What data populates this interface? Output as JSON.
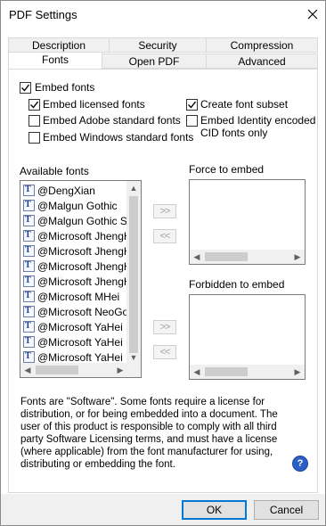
{
  "window": {
    "title": "PDF Settings"
  },
  "tabs_row_back": [
    {
      "label": "Description"
    },
    {
      "label": "Security"
    },
    {
      "label": "Compression"
    }
  ],
  "tabs_row_front": [
    {
      "label": "Fonts",
      "active": true
    },
    {
      "label": "Open PDF"
    },
    {
      "label": "Advanced"
    }
  ],
  "fonts": {
    "embed_fonts": {
      "label": "Embed fonts",
      "checked": true
    },
    "embed_licensed": {
      "label": "Embed licensed fonts",
      "checked": true
    },
    "embed_adobe": {
      "label": "Embed Adobe standard fonts",
      "checked": false
    },
    "embed_windows": {
      "label": "Embed Windows standard fonts",
      "checked": false
    },
    "create_subset": {
      "label": "Create font subset",
      "checked": true
    },
    "embed_identity": {
      "label_line1": "Embed Identity encoded",
      "label_line2": "CID fonts only",
      "checked": false
    },
    "available_label": "Available fonts",
    "force_label": "Force to embed",
    "forbidden_label": "Forbidden to embed",
    "available_fonts": [
      "@DengXian",
      "@Malgun Gothic",
      "@Malgun Gothic Semilight",
      "@Microsoft JhengHei",
      "@Microsoft JhengHei Bold",
      "@Microsoft JhengHei Light",
      "@Microsoft JhengHei UI",
      "@Microsoft MHei",
      "@Microsoft NeoGothic",
      "@Microsoft YaHei",
      "@Microsoft YaHei Light",
      "@Microsoft YaHei UI"
    ],
    "add_label": ">>",
    "remove_label": "<<",
    "description": "Fonts are \"Software\". Some fonts require a license for distribution, or for being embedded into a document. The user of this product is responsible to comply with all third party Software Licensing terms, and must have a license (where applicable) from the font manufacturer for using, distributing or embedding the font."
  },
  "buttons": {
    "ok": "OK",
    "cancel": "Cancel"
  },
  "icons": {
    "close": "close-icon",
    "help": "help-icon",
    "font": "truetype-font-icon"
  }
}
